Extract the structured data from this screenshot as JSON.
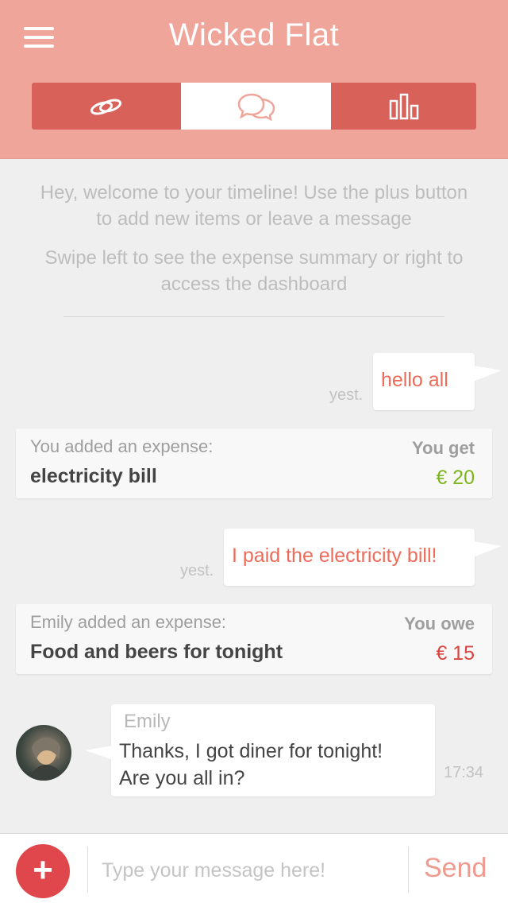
{
  "header": {
    "title": "Wicked Flat",
    "tabs": [
      {
        "icon": "rings-icon",
        "active": false
      },
      {
        "icon": "chat-bubbles-icon",
        "active": true
      },
      {
        "icon": "bar-chart-icon",
        "active": false
      }
    ]
  },
  "welcome": {
    "line1": "Hey, welcome to your timeline! Use the plus button to add new items or leave a message",
    "line2": "Swipe left to see the expense summary or right to access the dashboard"
  },
  "timeline": {
    "msg1": {
      "text": "hello all",
      "time": "yest."
    },
    "expense1": {
      "who": "You added an expense:",
      "description": "electricity bill",
      "label": "You get",
      "amount": "€ 20"
    },
    "msg2": {
      "text": "I paid the electricity bill!",
      "time": "yest."
    },
    "expense2": {
      "who": "Emily added an expense:",
      "description": "Food and beers for tonight",
      "label": "You owe",
      "amount": "€ 15"
    },
    "msg3": {
      "sender": "Emily",
      "line1": "Thanks, I got diner for tonight!",
      "line2": "Are you all in?",
      "time": "17:34"
    }
  },
  "composer": {
    "add_label": "+",
    "placeholder": "Type your message here!",
    "send_label": "Send"
  },
  "colors": {
    "header": "#f0a59b",
    "tabs": "#d8615a",
    "accent": "#ee6b5a",
    "positive": "#7cb51d",
    "negative": "#d9443f",
    "add_button": "#e0474c"
  }
}
